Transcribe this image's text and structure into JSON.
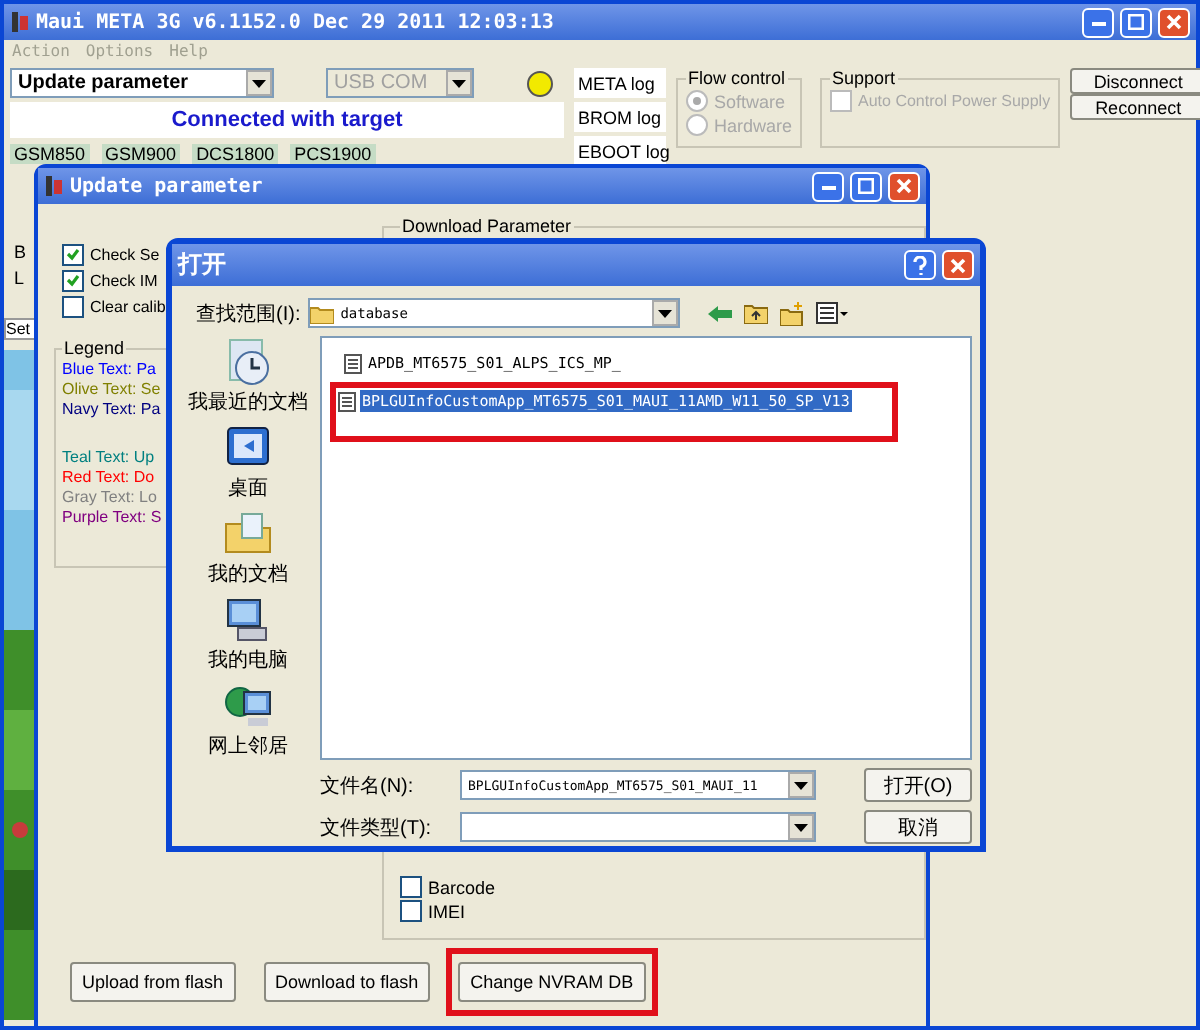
{
  "main_window": {
    "title": "Maui META 3G v6.1152.0 Dec 29 2011 12:03:13",
    "menu": [
      {
        "label": "Action",
        "disabled": true
      },
      {
        "label": "Options",
        "disabled": true
      },
      {
        "label": "Help",
        "disabled": true
      }
    ],
    "mode": {
      "value": "Update parameter"
    },
    "port": {
      "value": "USB COM",
      "disabled": true
    },
    "status": "Connected with target",
    "bands": [
      "GSM850",
      "GSM900",
      "DCS1800",
      "PCS1900"
    ],
    "log_buttons": [
      "META log",
      "BROM log",
      "EBOOT log"
    ],
    "flow_control": {
      "title": "Flow control",
      "options": [
        {
          "label": "Software",
          "selected": true,
          "disabled": true
        },
        {
          "label": "Hardware",
          "selected": false,
          "disabled": true
        }
      ]
    },
    "support": {
      "title": "Support",
      "options": [
        {
          "label": "Auto Control Power Supply",
          "checked": false,
          "disabled": true
        }
      ]
    },
    "buttons": [
      "Disconnect",
      "Reconnect"
    ],
    "side_labels": [
      "B",
      "L"
    ],
    "side_tab": "Set"
  },
  "update_window": {
    "title": "Update parameter",
    "options": [
      {
        "label": "Check Se",
        "checked": true
      },
      {
        "label": "Check IM",
        "checked": true
      },
      {
        "label": "Clear calib",
        "checked": false
      }
    ],
    "legend": {
      "title": "Legend",
      "items": [
        {
          "text": "Blue Text: Pa",
          "color": "#0000ff"
        },
        {
          "text": "Olive Text: Se",
          "color": "#808000"
        },
        {
          "text": "Navy Text: Pa",
          "color": "#000080"
        },
        {
          "text": "Teal Text: Up",
          "color": "#008080"
        },
        {
          "text": "Red Text: Do",
          "color": "#ff0000"
        },
        {
          "text": "Gray Text: Lo",
          "color": "#808080"
        },
        {
          "text": "Purple Text: S",
          "color": "#800080"
        }
      ]
    },
    "download_group": {
      "title": "Download Parameter",
      "options": [
        {
          "label": "Barcode",
          "checked": false
        },
        {
          "label": "IMEI",
          "checked": false
        }
      ]
    },
    "buttons": [
      {
        "label": "Upload from flash",
        "highlighted": false
      },
      {
        "label": "Download to flash",
        "highlighted": false
      },
      {
        "label": "Change NVRAM DB",
        "highlighted": true
      }
    ]
  },
  "open_dialog": {
    "title": "打开",
    "look_in_label": "查找范围(I):",
    "look_in": "database",
    "places": [
      "我最近的文档",
      "桌面",
      "我的文档",
      "我的电脑",
      "网上邻居"
    ],
    "files": [
      {
        "name": "APDB_MT6575_S01_ALPS_ICS_MP_",
        "selected": false,
        "highlighted": false
      },
      {
        "name": "BPLGUInfoCustomApp_MT6575_S01_MAUI_11AMD_W11_50_SP_V13",
        "selected": true,
        "highlighted": true
      }
    ],
    "file_name_label": "文件名(N):",
    "file_name": "BPLGUInfoCustomApp_MT6575_S01_MAUI_11",
    "file_type_label": "文件类型(T):",
    "buttons": [
      "打开(O)",
      "取消"
    ]
  }
}
